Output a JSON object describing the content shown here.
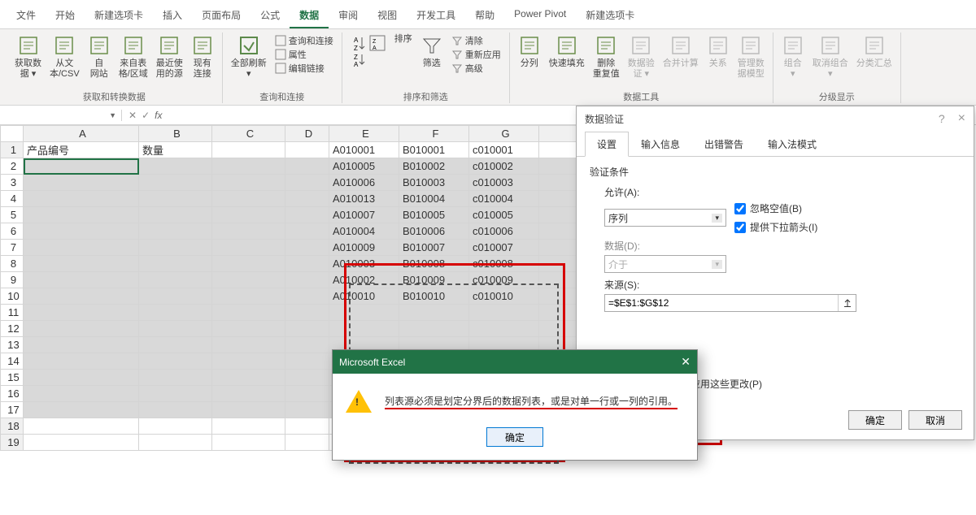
{
  "ribbonTabs": [
    "文件",
    "开始",
    "新建选项卡",
    "插入",
    "页面布局",
    "公式",
    "数据",
    "审阅",
    "视图",
    "开发工具",
    "帮助",
    "Power Pivot",
    "新建选项卡"
  ],
  "activeRibbonTab": 6,
  "ribbon": {
    "group0_label": "获取和转换数据",
    "g0_items": [
      "获取数\n据 ▾",
      "从文\n本/CSV",
      "自\n网站",
      "来自表\n格/区域",
      "最近使\n用的源",
      "现有\n连接"
    ],
    "group1_label": "查询和连接",
    "g1_refresh": "全部刷新\n▾",
    "g1_side": [
      "查询和连接",
      "属性",
      "编辑链接"
    ],
    "group2_label": "排序和筛选",
    "g2_sort": "排序",
    "g2_filter": "筛选",
    "g2_side": [
      "清除",
      "重新应用",
      "高级"
    ],
    "group3_label": "数据工具",
    "g3_items": [
      "分列",
      "快速填充",
      "删除\n重复值",
      "数据验\n证 ▾",
      "合并计算",
      "关系",
      "管理数\n据模型"
    ],
    "group4_label": "分级显示",
    "g4_items": [
      "组合\n▾",
      "取消组合\n▾",
      "分类汇总"
    ]
  },
  "nameBox": "",
  "colHeaders": [
    " ",
    "A",
    "B",
    "C",
    "D",
    "E",
    "F",
    "G",
    " "
  ],
  "row1": {
    "A": "产品编号",
    "B": "数量"
  },
  "dataEFG": [
    [
      "A010001",
      "B010001",
      "c010001"
    ],
    [
      "A010005",
      "B010002",
      "c010002"
    ],
    [
      "A010006",
      "B010003",
      "c010003"
    ],
    [
      "A010013",
      "B010004",
      "c010004"
    ],
    [
      "A010007",
      "B010005",
      "c010005"
    ],
    [
      "A010004",
      "B010006",
      "c010006"
    ],
    [
      "A010009",
      "B010007",
      "c010007"
    ],
    [
      "A010003",
      "B010008",
      "c010008"
    ],
    [
      "A010002",
      "B010009",
      "c010009"
    ],
    [
      "A010010",
      "B010010",
      "c010010"
    ]
  ],
  "numRows": 19,
  "dvDialog": {
    "title": "数据验证",
    "tabs": [
      "设置",
      "输入信息",
      "出错警告",
      "输入法模式"
    ],
    "activeTab": 0,
    "section": "验证条件",
    "allowLabel": "允许(A):",
    "allowValue": "序列",
    "ignoreBlank": "忽略空值(B)",
    "showDropdown": "提供下拉箭头(I)",
    "dataLabel": "数据(D):",
    "dataValue": "介于",
    "sourceLabel": "来源(S):",
    "sourceValue": "=$E$1:$G$12",
    "applyText": "其他单元格应用这些更改(P)",
    "ok": "确定",
    "cancel": "取消",
    "help": "?",
    "close": "×"
  },
  "errDialog": {
    "title": "Microsoft Excel",
    "msg": "列表源必须是划定分界后的数据列表，或是对单一行或一列的引用。",
    "ok": "确定",
    "close": "✕"
  }
}
